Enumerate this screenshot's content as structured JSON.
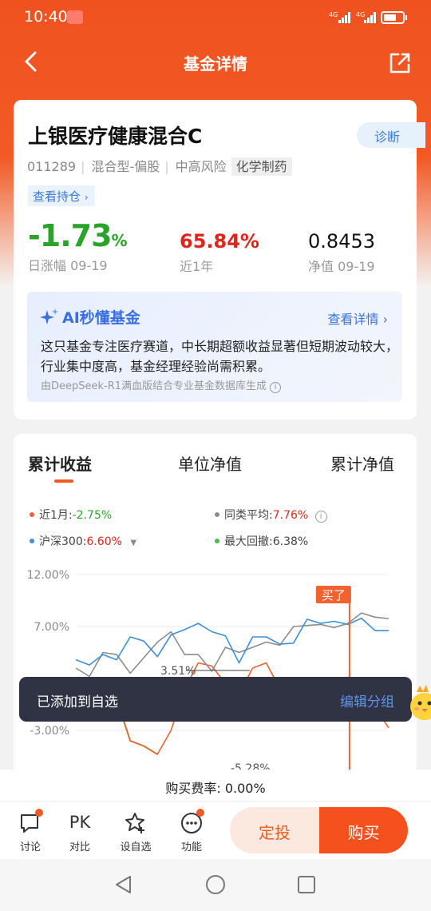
{
  "status": {
    "time": "10:40",
    "net1": "4G",
    "net2": "4G"
  },
  "nav": {
    "title": "基金详情"
  },
  "fund": {
    "name": "上银医疗健康混合C",
    "diagnose": "诊断",
    "code": "011289",
    "type": "混合型-偏股",
    "risk": "中高风险",
    "sector": "化学制药",
    "holdings_link": "查看持仓",
    "daily_change": "-1.73",
    "daily_change_unit": "%",
    "daily_label": "日涨幅 09-19",
    "year_return": "65.84%",
    "year_label": "近1年",
    "nav_value": "0.8453",
    "nav_label": "净值 09-19"
  },
  "ai": {
    "title": "AI秒懂基金",
    "link": "查看详情",
    "text": "这只基金专注医疗赛道，中长期超额收益显著但短期波动较大，行业集中度高，基金经理经验尚需积累。",
    "source": "由DeepSeek-R1满血版结合专业基金数据库生成"
  },
  "chart_tabs": [
    "累计收益",
    "单位净值",
    "累计净值"
  ],
  "legend": {
    "month_label": "近1月:",
    "month_value": "-2.75%",
    "peer_label": "同类平均:",
    "peer_value": "7.76%",
    "csi_label": "沪深300:",
    "csi_value": "6.60%",
    "dd_label": "最大回撤:",
    "dd_value": "6.38%"
  },
  "chart_data": {
    "type": "line",
    "yticks": [
      "12.00%",
      "7.00%",
      "-3.00%"
    ],
    "ylim": [
      -5.5,
      12
    ],
    "annotations": [
      "3.51%",
      "-5.28%",
      "买了"
    ],
    "series": [
      {
        "name": "近1月",
        "color": "#f0622f",
        "values": [
          1.5,
          -0.5,
          1.5,
          0,
          -4,
          -4.5,
          -5.3,
          -3,
          1,
          3.5,
          3.2,
          1.5,
          0.5,
          3.0,
          3.5,
          1.0,
          -0.7,
          0.8,
          1.5,
          -0.2,
          -0.5,
          0.2,
          -0.8,
          -2.75
        ]
      },
      {
        "name": "同类平均",
        "color": "#8c8c8c",
        "values": [
          3.0,
          2.2,
          4.5,
          4.3,
          2.5,
          4.0,
          5.5,
          6.5,
          4.3,
          4.3,
          2.7,
          5.0,
          4.5,
          5.0,
          5.5,
          5.2,
          7.0,
          7.1,
          7.2,
          6.9,
          7.3,
          8.3,
          7.9,
          7.76
        ]
      },
      {
        "name": "沪深300",
        "color": "#3d8fd8",
        "values": [
          3.8,
          3.3,
          4.3,
          3.8,
          6.0,
          5.6,
          4.1,
          6.2,
          6.7,
          7.3,
          6.5,
          6.1,
          3.5,
          6.0,
          6.0,
          5.3,
          5.4,
          7.7,
          7.3,
          7.5,
          7.2,
          7.8,
          6.6,
          6.6
        ]
      }
    ]
  },
  "toast": {
    "message": "已添加到自选",
    "action": "编辑分组"
  },
  "fee": "购买费率: 0.00%",
  "bottom": {
    "discuss": "讨论",
    "pk_icon": "PK",
    "pk": "对比",
    "watch": "设自选",
    "func": "功能",
    "dingtou": "定投",
    "buy": "购买"
  },
  "colors": {
    "brand": "#f05a23",
    "down": "#2aa32a",
    "up": "#e2231a",
    "blue": "#3d78cc"
  }
}
